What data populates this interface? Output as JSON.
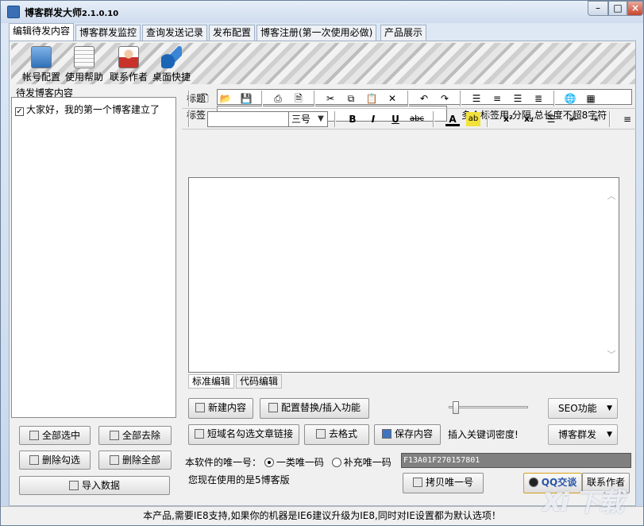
{
  "window": {
    "title": "博客群发大师",
    "version": "2.1.0.10",
    "controls": {
      "minimize": "–",
      "maximize": "□",
      "close": "×"
    }
  },
  "tabs": [
    "编辑待发内容",
    "博客群发监控",
    "查询发送记录",
    "发布配置",
    "博客注册(第一次使用必做)",
    "产品展示"
  ],
  "toolbar": [
    {
      "label": "帐号配置",
      "icon": "account-config-icon",
      "color": "#2f6fb8"
    },
    {
      "label": "使用帮助",
      "icon": "help-document-icon",
      "color": "#ececec"
    },
    {
      "label": "联系作者",
      "icon": "contact-person-icon",
      "color": "#c8322b"
    },
    {
      "label": "桌面快捷",
      "icon": "desktop-shortcut-icon",
      "color": "#1c64b5"
    }
  ],
  "queue": {
    "label": "待发博客内容",
    "items": [
      {
        "text": "大家好，我的第一个博客建立了",
        "checked": true
      }
    ]
  },
  "left_buttons": {
    "select_all": "全部选中",
    "deselect_all": "全部去除",
    "delete_checked": "删除勾选",
    "delete_all": "删除全部",
    "import": "导入数据"
  },
  "form": {
    "title_label": "标题",
    "title_value": "",
    "tag_label": "标签",
    "tag_value": "",
    "tag_hint": "多个标签用,分隔,总长度不超8字符"
  },
  "editor": {
    "font_value": "",
    "font_placeholder": "",
    "size_value": "三号",
    "row1_icons": [
      "new-doc-icon",
      "open-folder-icon",
      "save-icon",
      "print-icon",
      "print-preview-icon",
      "cut-icon",
      "copy-icon",
      "paste-icon",
      "delete-icon",
      "undo-icon",
      "redo-icon",
      "align-left-icon",
      "align-center-icon",
      "align-right-icon",
      "justify-icon",
      "link-icon",
      "table-icon"
    ],
    "row2_glyphs": {
      "bold": "B",
      "italic": "I",
      "underline": "U",
      "strike": "abc",
      "font_color": "A",
      "highlight": "ab",
      "superscript": "x²",
      "subscript": "x₂"
    },
    "body": "",
    "scroll_up": "︿",
    "scroll_down": "﹀",
    "mode_tabs": [
      "标准编辑",
      "代码编辑"
    ],
    "mode_active": 0
  },
  "actions": {
    "new_content": "新建内容",
    "config_replace": "配置替换/插入功能",
    "seo": "SEO功能",
    "short_domain": "短域名勾选文章链接",
    "clear_format": "去格式",
    "save_content": "保存内容",
    "keyword_density": "插入关键词密度!",
    "keyword_density_level": 0.05,
    "blog_send": "博客群发"
  },
  "license": {
    "label": "本软件的唯一号：",
    "radio1": "一类唯一码",
    "radio2": "补充唯一码",
    "radio_selected": 1,
    "code": "F13A01F270157801",
    "version_note": "您现在使用的是5博客版",
    "copy_button": "拷贝唯一号",
    "qq_button": "QQ交谈",
    "contact": "联系作者"
  },
  "status": "本产品,需要IE8支持,如果你的机器是IE6建议升级为IE8,同时对IE设置都为默认选项！",
  "watermark": "Xi 下载"
}
